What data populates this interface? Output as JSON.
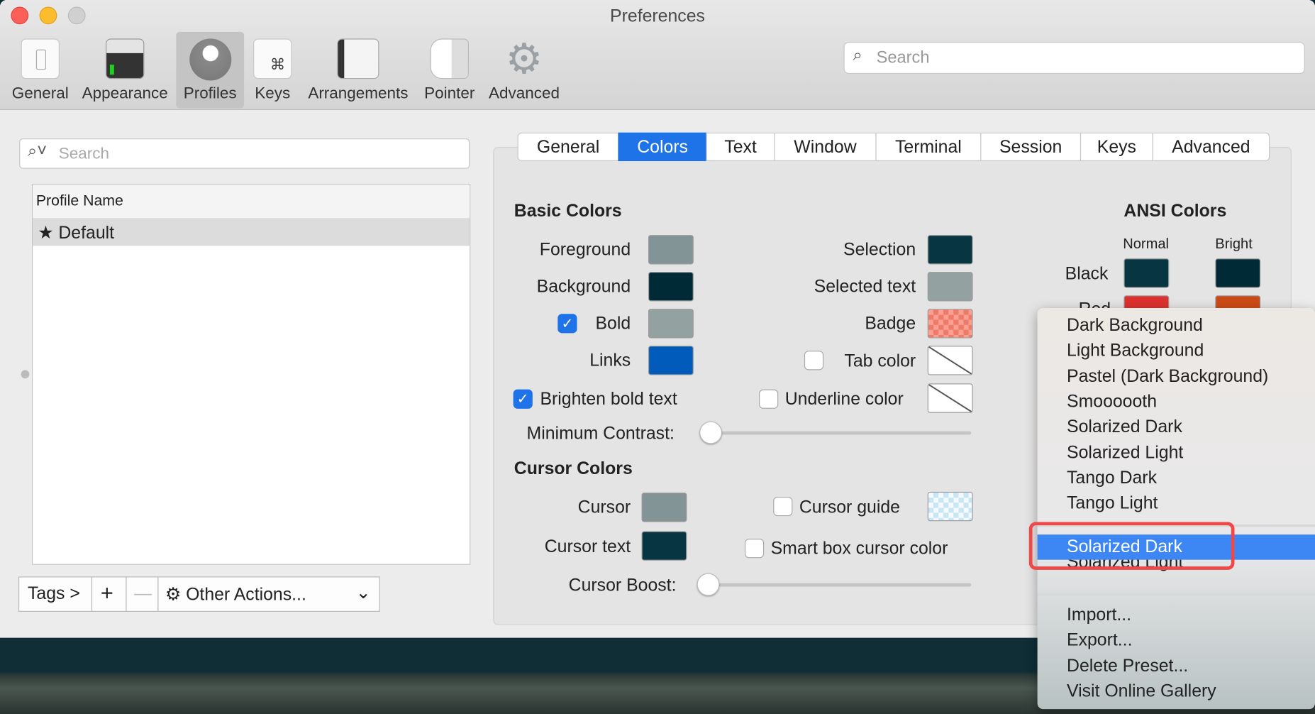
{
  "window": {
    "title": "Preferences"
  },
  "toolbar": {
    "items": [
      {
        "label": "General",
        "icon": "toggle-switch-icon"
      },
      {
        "label": "Appearance",
        "icon": "terminal-window-icon"
      },
      {
        "label": "Profiles",
        "icon": "user-silhouette-icon",
        "selected": true
      },
      {
        "label": "Keys",
        "icon": "command-key-icon"
      },
      {
        "label": "Arrangements",
        "icon": "window-arrangement-icon"
      },
      {
        "label": "Pointer",
        "icon": "mouse-icon"
      },
      {
        "label": "Advanced",
        "icon": "gear-icon"
      }
    ],
    "search_placeholder": "Search"
  },
  "profiles": {
    "search_placeholder": "Search",
    "column_header": "Profile Name",
    "rows": [
      {
        "name": "Default",
        "default": true
      }
    ],
    "buttons": {
      "tags": "Tags >",
      "add": "+",
      "remove": "—",
      "other_actions": "Other Actions..."
    }
  },
  "tabs": [
    {
      "label": "General"
    },
    {
      "label": "Colors",
      "selected": true
    },
    {
      "label": "Text"
    },
    {
      "label": "Window"
    },
    {
      "label": "Terminal"
    },
    {
      "label": "Session"
    },
    {
      "label": "Keys"
    },
    {
      "label": "Advanced"
    }
  ],
  "basic_colors": {
    "title": "Basic Colors",
    "foreground": {
      "label": "Foreground",
      "color": "#839496"
    },
    "background": {
      "label": "Background",
      "color": "#002b36"
    },
    "bold": {
      "label": "Bold",
      "color": "#93a1a1",
      "checked": true
    },
    "links": {
      "label": "Links",
      "color": "#005bbb"
    },
    "selection": {
      "label": "Selection",
      "color": "#073642"
    },
    "selected_text": {
      "label": "Selected text",
      "color": "#93a1a1"
    },
    "badge": {
      "label": "Badge",
      "color": "#f07a6a"
    },
    "tab_color": {
      "label": "Tab color",
      "checked": false
    },
    "brighten_bold": {
      "label": "Brighten bold text",
      "checked": true
    },
    "underline_color": {
      "label": "Underline color",
      "checked": false
    },
    "minimum_contrast": {
      "label": "Minimum Contrast:",
      "value": 0
    }
  },
  "cursor_colors": {
    "title": "Cursor Colors",
    "cursor": {
      "label": "Cursor",
      "color": "#839496"
    },
    "cursor_text": {
      "label": "Cursor text",
      "color": "#073642"
    },
    "cursor_guide": {
      "label": "Cursor guide",
      "checked": false,
      "color": "#c8e6f5"
    },
    "smart_box": {
      "label": "Smart box cursor color",
      "checked": false
    },
    "cursor_boost": {
      "label": "Cursor Boost:",
      "value": 0
    }
  },
  "ansi_colors": {
    "title": "ANSI Colors",
    "normal": "Normal",
    "bright": "Bright",
    "rows": [
      {
        "label": "Black",
        "normal": "#073642",
        "bright": "#002b36"
      },
      {
        "label": "Red",
        "normal": "#dc322f",
        "bright": "#cb4b16"
      }
    ]
  },
  "preset_menu": {
    "presets": [
      "Dark Background",
      "Light Background",
      "Pastel (Dark Background)",
      "Smoooooth",
      "Solarized Dark",
      "Solarized Light",
      "Tango Dark",
      "Tango Light"
    ],
    "custom": [
      "Solarized Dark",
      "Solarized Light"
    ],
    "highlighted": "Solarized Dark",
    "actions": [
      "Import...",
      "Export...",
      "Delete Preset...",
      "Visit Online Gallery"
    ],
    "highlight_color": "#3d87f5",
    "annotation_color": "#f04848"
  }
}
